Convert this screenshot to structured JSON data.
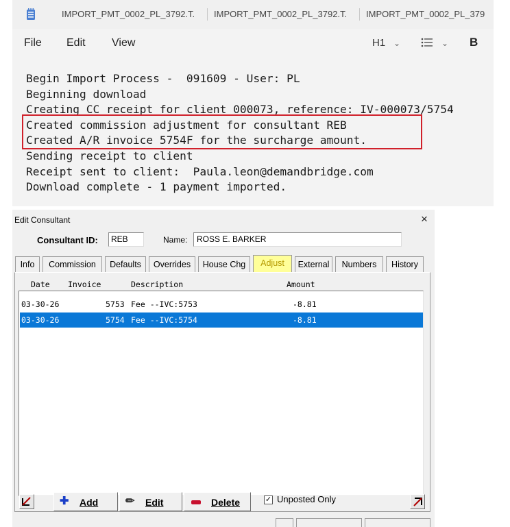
{
  "notepad": {
    "tabs": [
      "IMPORT_PMT_0002_PL_3792.T.",
      "IMPORT_PMT_0002_PL_3792.T.",
      "IMPORT_PMT_0002_PL_379"
    ],
    "menu": {
      "file": "File",
      "edit": "Edit",
      "view": "View"
    },
    "format": {
      "heading": "H1",
      "list_icon": "list-icon",
      "bold": "B"
    },
    "lines": [
      "Begin Import Process -  091609 - User: PL",
      "Beginning download",
      "Creating CC receipt for client 000073, reference: IV-000073/5754",
      "Created commission adjustment for consultant REB",
      "Created A/R invoice 5754F for the surcharge amount.",
      "Sending receipt to client",
      "Receipt sent to client:  Paula.leon@demandbridge.com",
      "Download complete - 1 payment imported."
    ],
    "highlight_color": "#d0202a"
  },
  "dialog": {
    "title": "Edit Consultant",
    "close": "×",
    "consultant_id_label": "Consultant ID:",
    "consultant_id": "REB",
    "name_label": "Name:",
    "name": "ROSS E. BARKER",
    "tabs": [
      "Info",
      "Commission",
      "Defaults",
      "Overrides",
      "House Chg",
      "Adjust",
      "External",
      "Numbers",
      "History"
    ],
    "active_tab": "Adjust",
    "columns": {
      "date": "Date",
      "invoice": "Invoice",
      "description": "Description",
      "amount": "Amount"
    },
    "rows": [
      {
        "date": "03-30-26",
        "invoice": "5753",
        "description": "Fee --IVC:5753",
        "amount": "-8.81",
        "selected": false
      },
      {
        "date": "03-30-26",
        "invoice": "5754",
        "description": "Fee --IVC:5754",
        "amount": "-8.81",
        "selected": true
      }
    ],
    "buttons": {
      "add": "Add",
      "edit": "Edit",
      "delete": "Delete"
    },
    "unposted_only_label": "Unposted Only",
    "unposted_only_checked": true,
    "selection_color": "#0a78d7"
  }
}
